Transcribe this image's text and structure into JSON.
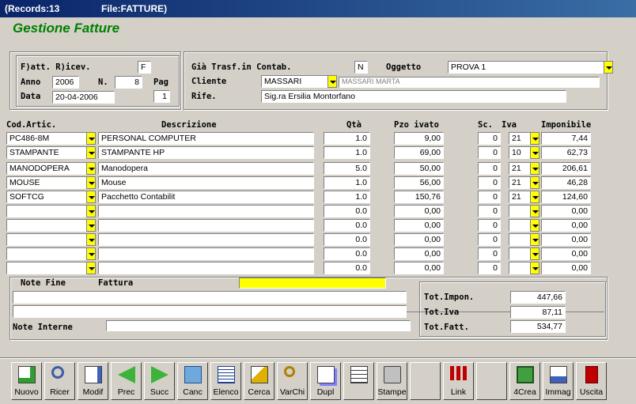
{
  "window": {
    "records": "(Records:13",
    "file": "File:FATTURE)"
  },
  "app_title": "Gestione Fatture",
  "header": {
    "fatt_label": "F)att. R)icev.",
    "fatt_value": "F",
    "anno_label": "Anno",
    "anno_value": "2006",
    "n_label": "N.",
    "n_value": "8",
    "pag_label": "Pag",
    "pag_value": "1",
    "data_label": "Data",
    "data_value": "20-04-2006",
    "trasf_label": "Già Trasf.in Contab.",
    "trasf_value": "N",
    "oggetto_label": "Oggetto",
    "oggetto_value": "PROVA 1",
    "cliente_label": "Cliente",
    "cliente_value": "MASSARI",
    "cliente_name": "MASSARI MARTA",
    "rife_label": "Rife.",
    "rife_value": "Sig.ra Ersilia Montorfano"
  },
  "columns": {
    "cod": "Cod.Artic.",
    "descr": "Descrizione",
    "qta": "Qtà",
    "pzo": "Pzo ivato",
    "sc": "Sc.",
    "iva": "Iva",
    "impon": "Imponibile"
  },
  "rows": [
    {
      "cod": "PC486-8M",
      "descr": "PERSONAL COMPUTER",
      "qta": "1.0",
      "pzo": "9,00",
      "sc": "0",
      "iva": "21",
      "impon": "7,44"
    },
    {
      "cod": "STAMPANTE",
      "descr": "STAMPANTE HP",
      "qta": "1.0",
      "pzo": "69,00",
      "sc": "0",
      "iva": "10",
      "impon": "62,73"
    },
    {
      "cod": "MANODOPERA",
      "descr": "Manodopera",
      "qta": "5.0",
      "pzo": "50,00",
      "sc": "0",
      "iva": "21",
      "impon": "206,61"
    },
    {
      "cod": "MOUSE",
      "descr": "Mouse",
      "qta": "1.0",
      "pzo": "56,00",
      "sc": "0",
      "iva": "21",
      "impon": "46,28"
    },
    {
      "cod": "SOFTCG",
      "descr": "Pacchetto Contabilit",
      "qta": "1.0",
      "pzo": "150,76",
      "sc": "0",
      "iva": "21",
      "impon": "124,60"
    },
    {
      "cod": "",
      "descr": "",
      "qta": "0.0",
      "pzo": "0,00",
      "sc": "0",
      "iva": "",
      "impon": "0,00"
    },
    {
      "cod": "",
      "descr": "",
      "qta": "0.0",
      "pzo": "0,00",
      "sc": "0",
      "iva": "",
      "impon": "0,00"
    },
    {
      "cod": "",
      "descr": "",
      "qta": "0.0",
      "pzo": "0,00",
      "sc": "0",
      "iva": "",
      "impon": "0,00"
    },
    {
      "cod": "",
      "descr": "",
      "qta": "0.0",
      "pzo": "0,00",
      "sc": "0",
      "iva": "",
      "impon": "0,00"
    },
    {
      "cod": "",
      "descr": "",
      "qta": "0.0",
      "pzo": "0,00",
      "sc": "0",
      "iva": "",
      "impon": "0,00"
    }
  ],
  "footer": {
    "note_fine_label": "Note Fine",
    "fattura_label": "Fattura",
    "note_interne_label": "Note Interne",
    "tot_impon_label": "Tot.Impon.",
    "tot_impon": "447,66",
    "tot_iva_label": "Tot.Iva",
    "tot_iva": "87,11",
    "tot_fatt_label": "Tot.Fatt.",
    "tot_fatt": "534,77"
  },
  "toolbar": [
    {
      "label": "Nuovo",
      "icon": "new-document-icon"
    },
    {
      "label": "Ricer",
      "icon": "search-icon"
    },
    {
      "label": "Modif",
      "icon": "edit-icon"
    },
    {
      "label": "Prec",
      "icon": "arrow-left-icon"
    },
    {
      "label": "Succ",
      "icon": "arrow-right-icon"
    },
    {
      "label": "Canc",
      "icon": "trash-icon"
    },
    {
      "label": "Elenco",
      "icon": "list-icon"
    },
    {
      "label": "Cerca",
      "icon": "find-icon"
    },
    {
      "label": "VarChi",
      "icon": "keys-icon"
    },
    {
      "label": "Dupl",
      "icon": "duplicate-icon"
    },
    {
      "label": "",
      "icon": "notepad-icon"
    },
    {
      "label": "Stampe",
      "icon": "printer-icon"
    },
    {
      "label": "",
      "icon": ""
    },
    {
      "label": "Link",
      "icon": "link-icon"
    },
    {
      "label": "",
      "icon": ""
    },
    {
      "label": "4Crea",
      "icon": "create-icon"
    },
    {
      "label": "Immag",
      "icon": "image-icon"
    },
    {
      "label": "Uscita",
      "icon": "exit-door-icon"
    }
  ]
}
